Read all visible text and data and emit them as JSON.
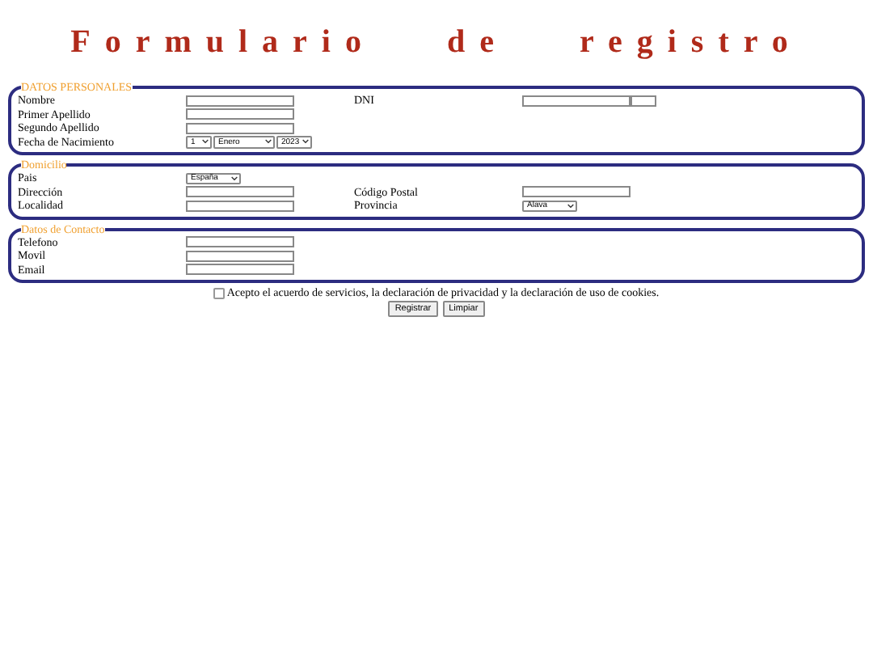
{
  "title": "Formulario de registro",
  "sections": [
    {
      "legend": "DATOS PERSONALES",
      "rows": [
        {
          "left": {
            "label": "Nombre",
            "kind": "text"
          },
          "right": {
            "label": "DNI",
            "kind": "dni"
          }
        },
        {
          "left": {
            "label": "Primer Apellido",
            "kind": "text"
          }
        },
        {
          "left": {
            "label": "Segundo Apellido",
            "kind": "text"
          }
        },
        {
          "left": {
            "label": "Fecha de Nacimiento",
            "kind": "date",
            "values": [
              "1",
              "Enero",
              "2023"
            ]
          }
        }
      ]
    },
    {
      "legend": "Domicilio",
      "rows": [
        {
          "left": {
            "label": "Pais",
            "kind": "select",
            "values": [
              "España"
            ]
          }
        },
        {
          "left": {
            "label": "Dirección",
            "kind": "text"
          },
          "right": {
            "label": "Código Postal",
            "kind": "text"
          }
        },
        {
          "left": {
            "label": "Localidad",
            "kind": "text"
          },
          "right": {
            "label": "Provincia",
            "kind": "select",
            "values": [
              "Alava"
            ]
          }
        }
      ]
    },
    {
      "legend": "Datos de Contacto",
      "rows": [
        {
          "left": {
            "label": "Telefono",
            "kind": "text"
          }
        },
        {
          "left": {
            "label": "Movil",
            "kind": "text"
          }
        },
        {
          "left": {
            "label": "Email",
            "kind": "text"
          }
        }
      ]
    }
  ],
  "agreement": {
    "text": "Acepto el acuerdo de servicios, la declaración de privacidad y la declaración de uso de cookies.",
    "checked": false
  },
  "buttons": [
    "Registrar",
    "Limpiar"
  ]
}
